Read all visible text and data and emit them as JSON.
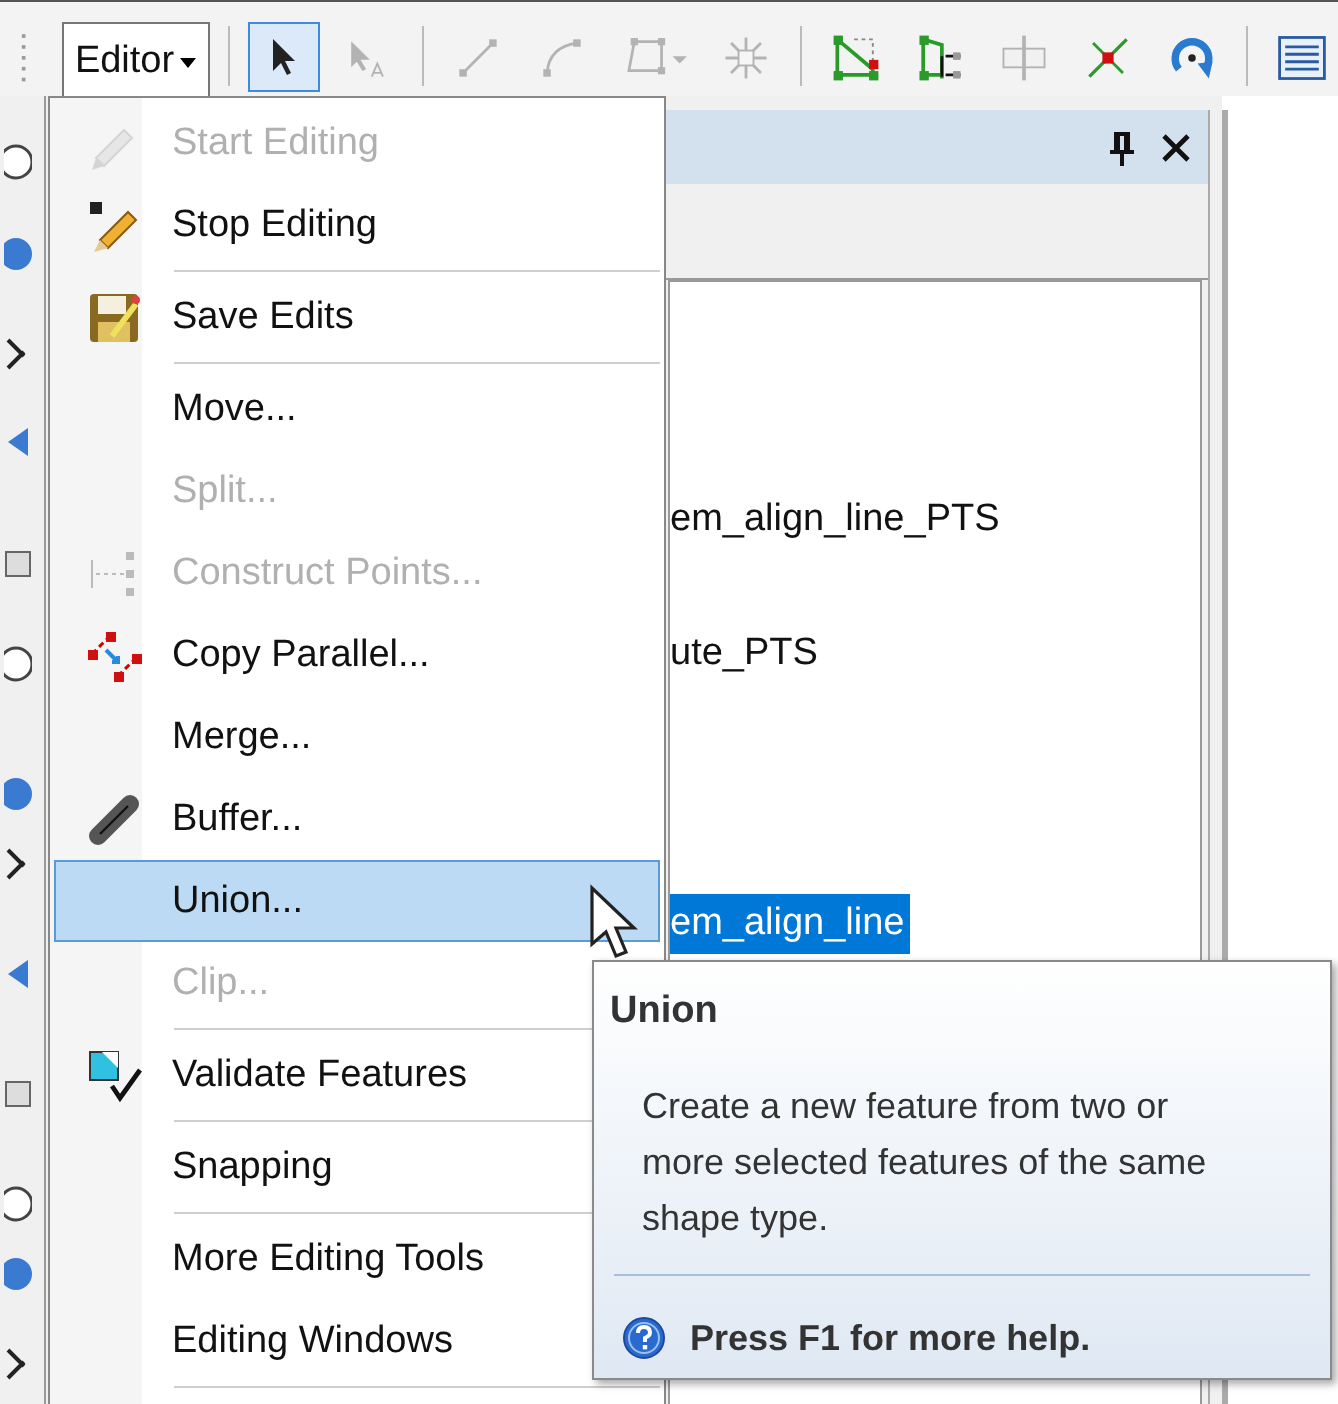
{
  "toolbar": {
    "menu_button": {
      "label": "Editor",
      "open": true
    },
    "tools": [
      {
        "selected": true,
        "disabled": false
      },
      {
        "selected": false,
        "disabled": true
      },
      {
        "selected": false,
        "disabled": true
      },
      {
        "selected": false,
        "disabled": true
      },
      {
        "selected": false,
        "disabled": true
      },
      {
        "selected": false,
        "disabled": true
      },
      {
        "selected": false,
        "disabled": false
      },
      {
        "selected": false,
        "disabled": false
      },
      {
        "selected": false,
        "disabled": true
      },
      {
        "selected": false,
        "disabled": false
      },
      {
        "selected": false,
        "disabled": false
      },
      {
        "selected": false,
        "disabled": false
      }
    ]
  },
  "panel": {
    "rows": [
      {
        "text": "em_align_line_PTS",
        "selected": false
      },
      {
        "text": "ute_PTS",
        "selected": false
      },
      {
        "text": "em_align_line",
        "selected": true
      }
    ]
  },
  "menu": {
    "items": [
      {
        "kind": "item",
        "label": "Start Editing",
        "disabled": true,
        "selected": false
      },
      {
        "kind": "item",
        "label": "Stop Editing",
        "disabled": false,
        "selected": false
      },
      {
        "kind": "separator"
      },
      {
        "kind": "item",
        "label": "Save Edits",
        "disabled": false,
        "selected": false
      },
      {
        "kind": "separator"
      },
      {
        "kind": "item",
        "label": "Move...",
        "disabled": false,
        "selected": false
      },
      {
        "kind": "item",
        "label": "Split...",
        "disabled": true,
        "selected": false
      },
      {
        "kind": "item",
        "label": "Construct Points...",
        "disabled": true,
        "selected": false
      },
      {
        "kind": "item",
        "label": "Copy Parallel...",
        "disabled": false,
        "selected": false
      },
      {
        "kind": "item",
        "label": "Merge...",
        "disabled": false,
        "selected": false
      },
      {
        "kind": "item",
        "label": "Buffer...",
        "disabled": false,
        "selected": false
      },
      {
        "kind": "item",
        "label": "Union...",
        "disabled": false,
        "selected": true
      },
      {
        "kind": "item",
        "label": "Clip...",
        "disabled": true,
        "selected": false
      },
      {
        "kind": "separator"
      },
      {
        "kind": "item",
        "label": "Validate Features",
        "disabled": false,
        "selected": false
      },
      {
        "kind": "separator"
      },
      {
        "kind": "item",
        "label": "Snapping",
        "disabled": false,
        "selected": false
      },
      {
        "kind": "separator"
      },
      {
        "kind": "item",
        "label": "More Editing Tools",
        "disabled": false,
        "selected": false
      },
      {
        "kind": "item",
        "label": "Editing Windows",
        "disabled": false,
        "selected": false
      },
      {
        "kind": "separator"
      }
    ]
  },
  "tooltip": {
    "title": "Union",
    "description": "Create a new feature from two or more selected features of the same shape type.",
    "help": "Press F1 for more help."
  }
}
